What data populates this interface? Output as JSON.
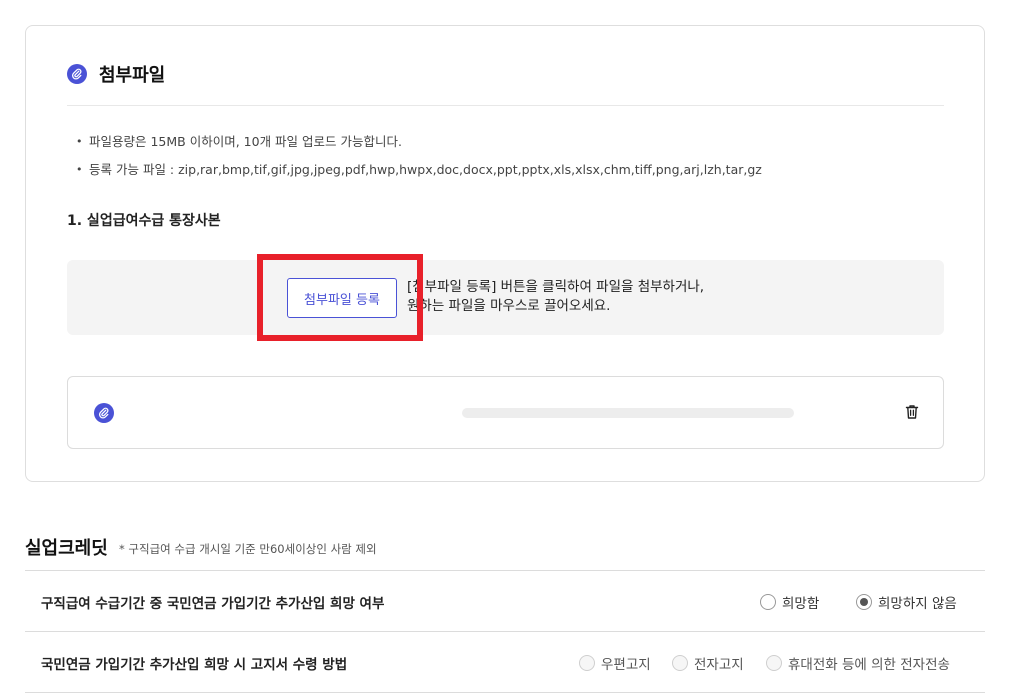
{
  "attachment": {
    "title": "첨부파일",
    "notes": [
      "파일용량은 15MB 이하이며, 10개 파일 업로드 가능합니다.",
      "등록 가능 파일 : zip,rar,bmp,tif,gif,jpg,jpeg,pdf,hwp,hwpx,doc,docx,ppt,pptx,xls,xlsx,chm,tiff,png,arj,lzh,tar,gz"
    ],
    "section_label": "1. 실업급여수급 통장사본",
    "register_button": "첨부파일 등록",
    "drop_text_line1": "[첨부파일 등록] 버튼을 클릭하여 파일을 첨부하거나,",
    "drop_text_line2": "원하는 파일을 마우스로 끌어오세요.",
    "highlight_color": "#e8202a",
    "accent_color": "#4a52d6"
  },
  "credit": {
    "title": "실업크레딧",
    "note": "* 구직급여 수급 개시일 기준 만60세이상인 사람 제외",
    "questions": [
      {
        "label": "구직급여 수급기간 중 국민연금 가입기간 추가산입 희망 여부",
        "options": [
          {
            "label": "희망함",
            "checked": false
          },
          {
            "label": "희망하지 않음",
            "checked": true
          }
        ]
      },
      {
        "label": "국민연금 가입기간 추가산입 희망 시 고지서 수령 방법",
        "options": [
          {
            "label": "우편고지",
            "checked": false,
            "disabled": true
          },
          {
            "label": "전자고지",
            "checked": false,
            "disabled": true
          },
          {
            "label": "휴대전화 등에 의한 전자전송",
            "checked": false,
            "disabled": true
          }
        ]
      }
    ]
  },
  "icons": {
    "attachment": "paperclip-icon",
    "delete": "trash-icon"
  }
}
